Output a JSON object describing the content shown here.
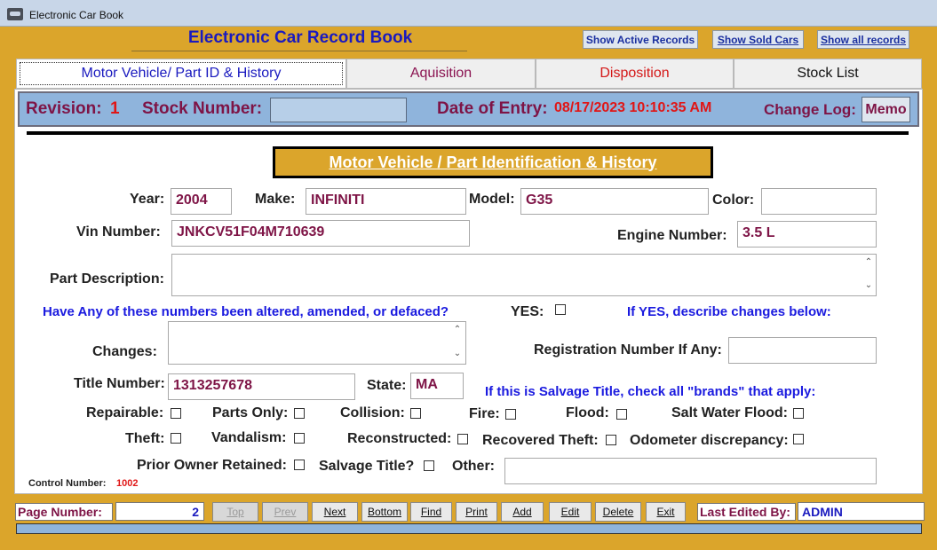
{
  "window": {
    "title": "Electronic Car Book"
  },
  "header": {
    "app_title": "Electronic Car Record Book",
    "show_active": "Show Active Records",
    "show_sold": "Show Sold Cars",
    "show_all": "Show all records"
  },
  "tabs": [
    {
      "label": "Motor Vehicle/ Part ID & History"
    },
    {
      "label": "Aquisition"
    },
    {
      "label": "Disposition"
    },
    {
      "label": "Stock List"
    }
  ],
  "revision_bar": {
    "revision_label": "Revision:",
    "revision_value": "1",
    "stock_label": "Stock Number:",
    "stock_value": "",
    "date_label": "Date of Entry:",
    "date_value": "08/17/2023 10:10:35 AM",
    "changelog_label": "Change Log:",
    "memo_label": "Memo"
  },
  "section_title": "Motor Vehicle / Part Identification & History",
  "form": {
    "year_label": "Year:",
    "year_value": "2004",
    "make_label": "Make:",
    "make_value": "INFINITI",
    "model_label": "Model:",
    "model_value": "G35",
    "color_label": "Color:",
    "color_value": "",
    "vin_label": "Vin  Number:",
    "vin_value": "JNKCV51F04M710639",
    "engine_label": "Engine Number:",
    "engine_value": "3.5 L",
    "part_desc_label": "Part Description:",
    "part_desc_value": "",
    "altered_question": "Have Any of these numbers been altered, amended, or defaced?",
    "yes_label": "YES:",
    "if_yes_text": "If YES, describe changes below:",
    "changes_label": "Changes:",
    "changes_value": "",
    "registration_label": "Registration Number If Any:",
    "registration_value": "",
    "title_label": "Title Number:",
    "title_value": "1313257678",
    "state_label": "State:",
    "state_value": "MA",
    "salvage_text": "If this is Salvage Title, check all \"brands\" that apply:",
    "repairable_label": "Repairable:",
    "parts_only_label": "Parts Only:",
    "collision_label": "Collision:",
    "fire_label": "Fire:",
    "flood_label": "Flood:",
    "salt_water_label": "Salt Water Flood:",
    "theft_label": "Theft:",
    "vandalism_label": "Vandalism:",
    "reconstructed_label": "Reconstructed:",
    "recovered_theft_label": "Recovered Theft:",
    "odometer_label": "Odometer discrepancy:",
    "prior_owner_label": "Prior Owner Retained:",
    "salvage_title_label": "Salvage Title?",
    "other_label": "Other:",
    "other_value": "",
    "control_label": "Control Number:",
    "control_value": "1002"
  },
  "nav": {
    "page_number_label": "Page Number:",
    "page_number_value": "2",
    "top": "Top",
    "prev": "Prev",
    "next": "Next",
    "bottom": "Bottom",
    "find": "Find",
    "print": "Print",
    "add": "Add",
    "edit": "Edit",
    "delete": "Delete",
    "exit": "Exit",
    "last_edited_label": "Last Edited By:",
    "last_edited_value": "ADMIN"
  },
  "colors": {
    "background": "#dba52b",
    "accent_blue": "#8fb4dc",
    "label_maroon": "#7e1446",
    "value_red": "#e01616"
  }
}
